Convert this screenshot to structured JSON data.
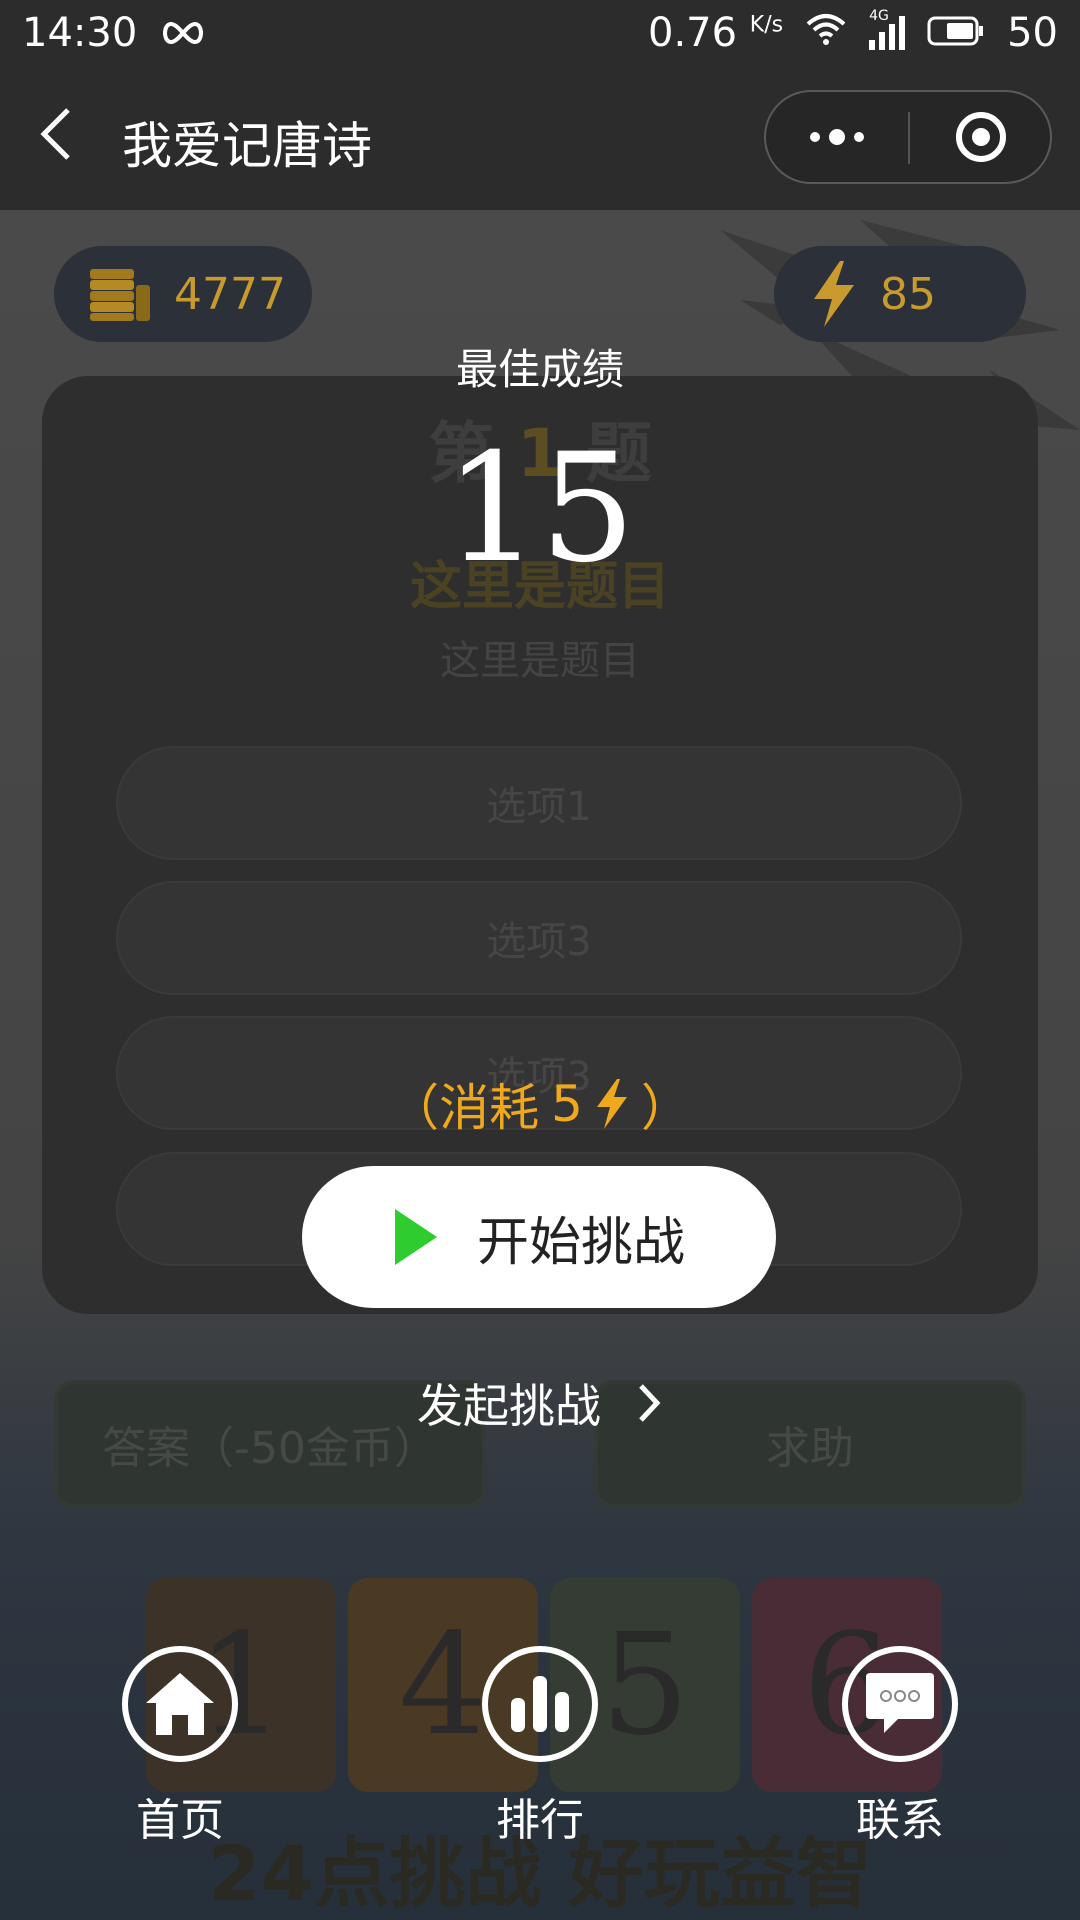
{
  "status_bar": {
    "time": "14:30",
    "speed": "0.76",
    "speed_unit": "K/s",
    "network": "4G",
    "battery": "50"
  },
  "nav": {
    "title": "我爱记唐诗"
  },
  "stats": {
    "coins": "4777",
    "energy": "85"
  },
  "question": {
    "number_prefix": "第",
    "number": "1",
    "number_suffix": "题",
    "title": "这里是题目",
    "subtitle": "这里是题目",
    "options": [
      "选项1",
      "选项3",
      "选项3",
      ""
    ]
  },
  "actions": {
    "answer": "答案（-50金币）",
    "help": "求助"
  },
  "tiles": [
    "1",
    "4",
    "5",
    "6"
  ],
  "game_caption": "24点挑战 好玩益智",
  "overlay": {
    "best_label": "最佳成绩",
    "best_score": "15",
    "cost_open": "（消耗",
    "cost_value": "5",
    "cost_close": "）",
    "start_label": "开始挑战",
    "launch_label": "发起挑战"
  },
  "tabs": [
    {
      "label": "首页",
      "icon": "home-icon"
    },
    {
      "label": "排行",
      "icon": "bar-chart-icon"
    },
    {
      "label": "联系",
      "icon": "message-icon"
    }
  ],
  "colors": {
    "accent": "#f0a81c",
    "play": "#2ecc2e",
    "coin": "#c99a2e"
  }
}
